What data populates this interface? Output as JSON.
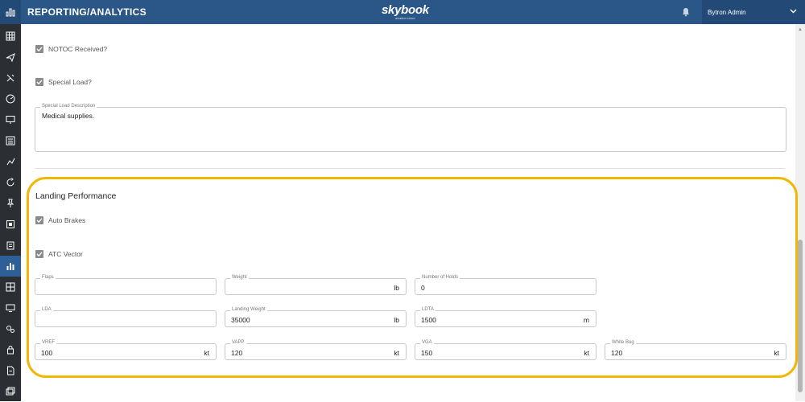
{
  "header": {
    "title": "REPORTING/ANALYTICS",
    "logo": "skybook",
    "logo_sub": "aviation cloud",
    "user_name": "Bytron Admin",
    "colors": {
      "header_bg": "#2a5688",
      "sidebar_bg": "#2b2f33",
      "highlight": "#f2b705"
    }
  },
  "sidebar": {
    "icons": [
      "table-icon",
      "airplane-icon",
      "flight-ops-icon",
      "gauge-icon",
      "presentation-icon",
      "list-icon",
      "routes-icon",
      "refresh-icon",
      "pin-icon",
      "document-icon",
      "clipboard-icon",
      "reporting-icon",
      "spreadsheet-icon",
      "monitor-icon",
      "settings-icon",
      "lock-icon",
      "file-icon",
      "gallery-icon"
    ],
    "active_index": 11
  },
  "form": {
    "notoc_label": "NOTOC Received?",
    "notoc_checked": true,
    "special_load_label": "Special Load?",
    "special_load_checked": true,
    "special_load_desc_caption": "Special Load Description",
    "special_load_desc_value": "Medical supplies."
  },
  "landing": {
    "title": "Landing Performance",
    "auto_brakes_label": "Auto Brakes",
    "auto_brakes_checked": true,
    "atc_vector_label": "ATC Vector",
    "atc_vector_checked": true,
    "fields": {
      "flaps": {
        "caption": "Flaps",
        "value": "",
        "unit": ""
      },
      "weight": {
        "caption": "Weight",
        "value": "",
        "unit": "lb"
      },
      "holds": {
        "caption": "Number of Holds",
        "value": "0",
        "unit": ""
      },
      "lda": {
        "caption": "LDA",
        "value": "",
        "unit": ""
      },
      "landing_weight": {
        "caption": "Landing Weight",
        "value": "35000",
        "unit": "lb"
      },
      "ldta": {
        "caption": "LDTA",
        "value": "1500",
        "unit": "m"
      },
      "vref": {
        "caption": "VREF",
        "value": "100",
        "unit": "kt"
      },
      "vapp": {
        "caption": "VAPP",
        "value": "120",
        "unit": "kt"
      },
      "vga": {
        "caption": "VGA",
        "value": "150",
        "unit": "kt"
      },
      "white_bug": {
        "caption": "White Bug",
        "value": "120",
        "unit": "kt"
      }
    }
  }
}
